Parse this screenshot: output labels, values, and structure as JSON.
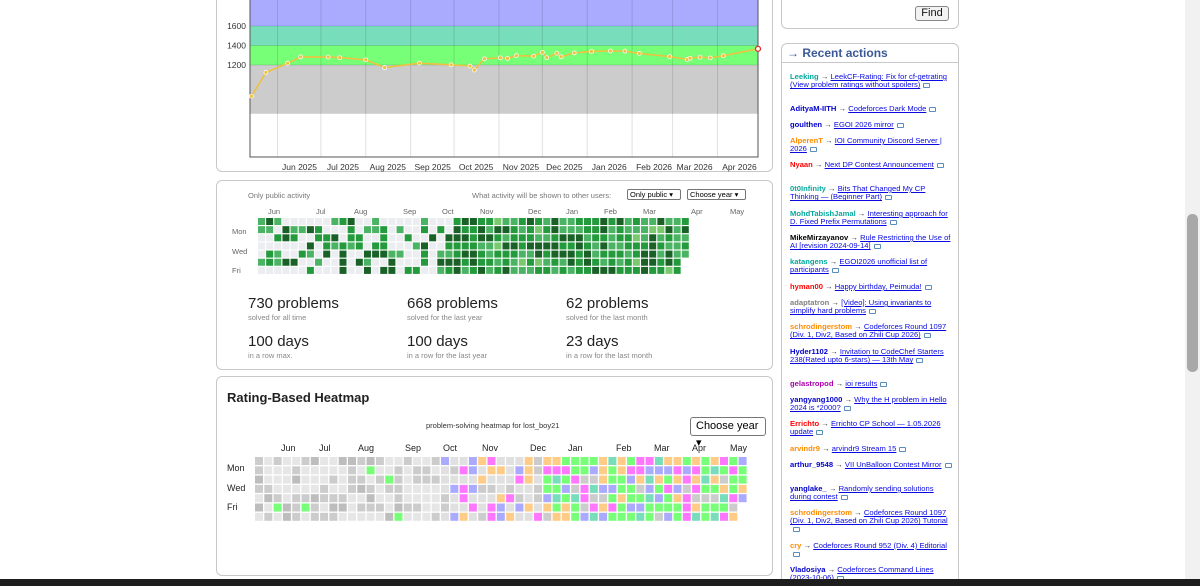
{
  "rating_chart": {
    "type": "line",
    "y_tick_labels": [
      "1600",
      "1400",
      "1200"
    ],
    "x_tick_labels": [
      "Jun 2025",
      "Jul 2025",
      "Aug 2025",
      "Sep 2025",
      "Oct 2025",
      "Nov 2025",
      "Dec 2025",
      "Jan 2026",
      "Feb 2026",
      "Mar 2026",
      "Apr 2026"
    ],
    "bands": [
      {
        "from": 1600,
        "to": 2000,
        "color": "#aaaaff"
      },
      {
        "from": 1400,
        "to": 1600,
        "color": "#77ddbb"
      },
      {
        "from": 1200,
        "to": 1400,
        "color": "#77ff77"
      },
      {
        "from": 700,
        "to": 1200,
        "color": "#cccccc"
      }
    ],
    "line_color": "#edc240",
    "last_point_color": "#e03030"
  },
  "chart_data": {
    "type": "line",
    "x": [
      "2025-05-14",
      "2025-05-24",
      "2025-06-08",
      "2025-06-17",
      "2025-07-06",
      "2025-07-14",
      "2025-08-01",
      "2025-08-14",
      "2025-09-07",
      "2025-09-29",
      "2025-10-12",
      "2025-10-15",
      "2025-10-22",
      "2025-11-02",
      "2025-11-07",
      "2025-11-13",
      "2025-11-25",
      "2025-12-01",
      "2025-12-04",
      "2025-12-11",
      "2025-12-14",
      "2025-12-23",
      "2026-01-04",
      "2026-01-17",
      "2026-01-27",
      "2026-02-06",
      "2026-02-27",
      "2026-03-11",
      "2026-03-13",
      "2026-03-20",
      "2026-03-27",
      "2026-04-05",
      "2026-04-29"
    ],
    "y": [
      880,
      1124,
      1218,
      1283,
      1281,
      1276,
      1253,
      1174,
      1219,
      1202,
      1190,
      1148,
      1264,
      1274,
      1268,
      1296,
      1291,
      1330,
      1275,
      1321,
      1284,
      1324,
      1339,
      1344,
      1342,
      1319,
      1286,
      1257,
      1270,
      1280,
      1273,
      1295,
      1366
    ],
    "ylim": [
      700,
      2000
    ]
  },
  "activity": {
    "only_public_label": "Only public activity",
    "shown_question": "What activity will be shown to other users:",
    "visibility_value": "Only public",
    "year_value": "Choose year",
    "months": [
      "Jun",
      "Jul",
      "Aug",
      "Sep",
      "Oct",
      "Nov",
      "Dec",
      "Jan",
      "Feb",
      "Mar",
      "Apr",
      "May"
    ],
    "days": [
      "Mon",
      "Wed",
      "Fri"
    ],
    "stats": [
      {
        "value": "730 problems",
        "label": "solved for all time"
      },
      {
        "value": "668 problems",
        "label": "solved for the last year"
      },
      {
        "value": "62 problems",
        "label": "solved for the last month"
      },
      {
        "value": "100 days",
        "label": "in a row max."
      },
      {
        "value": "100 days",
        "label": "in a row for the last year"
      },
      {
        "value": "23 days",
        "label": "in a row for the last month"
      }
    ]
  },
  "heatmap": {
    "title": "Rating-Based Heatmap",
    "caption": "problem-solving heatmap for lost_boy21",
    "year_value": "Choose year",
    "months": [
      "Jun",
      "Jul",
      "Aug",
      "Sep",
      "Oct",
      "Nov",
      "Dec",
      "Jan",
      "Feb",
      "Mar",
      "Apr",
      "May"
    ],
    "days": [
      "Mon",
      "Wed",
      "Fri"
    ]
  },
  "find": {
    "button_label": "Find"
  },
  "recent_actions": {
    "arrow": "→",
    "title": "Recent actions",
    "items": [
      {
        "user": "Leeking",
        "color": "#03a89e",
        "title": "LeekCF-Rating: Fix for cf-getrating (View problem ratings without spoilers)"
      },
      {
        "user": "AdityaM-IITH",
        "color": "#0000cc",
        "title": "Codeforces Dark Mode"
      },
      {
        "user": "goulthen",
        "color": "#0000cc",
        "title": "EGOI 2026 mirror"
      },
      {
        "user": "AlperenT",
        "color": "#ff8c00",
        "title": "IOI Community Discord Server | 2026"
      },
      {
        "user": "Nyaan",
        "color": "#ff0000",
        "title": "Next DP Contest Announcement"
      },
      {
        "user": "0t0Infinity",
        "color": "#03a89e",
        "title": "Bits That Changed My CP Thinking — (Beginner Part)"
      },
      {
        "user": "MohdTabishJamal",
        "color": "#03a89e",
        "title": "Interesting approach for D. Fixed Prefix Permutations"
      },
      {
        "user": "MikeMirzayanov",
        "color": "#000000",
        "title": "Rule Restricting the Use of AI [revision 2024-09-14]"
      },
      {
        "user": "katangens",
        "color": "#03a89e",
        "title": "EGOI2026 unofficial list of participants"
      },
      {
        "user": "hyman00",
        "color": "#ff0000",
        "title": "Happy birthday, Peimuda!"
      },
      {
        "user": "adaptatron",
        "color": "#808080",
        "title": "[Video]: Using invariants to simplify hard problems"
      },
      {
        "user": "schrodingerstom",
        "color": "#ff8c00",
        "title": "Codeforces Round 1097 (Div. 1, Div2, Based on Zhili Cup 2026)"
      },
      {
        "user": "Hyder1102",
        "color": "#0000cc",
        "title": "Invitation to CodeChef Starters 238(Rated upto 6-stars) — 13th May"
      },
      {
        "user": "gelastropod",
        "color": "#aa00aa",
        "title": "ioi results"
      },
      {
        "user": "yangyang1000",
        "color": "#0000cc",
        "title": "Why the H problem in Hello 2024 is *2000?"
      },
      {
        "user": "Errichto",
        "color": "#ff0000",
        "title": "Errichto CP School — 1.05.2026 update"
      },
      {
        "user": "arvindr9",
        "color": "#ff8c00",
        "title": "arvindr9 Stream 15"
      },
      {
        "user": "arthur_9548",
        "color": "#0000cc",
        "title": "VII UnBalloon Contest Mirror"
      },
      {
        "user": "yanglake_",
        "color": "#0000cc",
        "title": "Randomly sending solutions during contest"
      },
      {
        "user": "schrodingerstom",
        "color": "#ff8c00",
        "title": "Codeforces Round 1097 (Div. 1, Div2, Based on Zhili Cup 2026) Tutorial"
      },
      {
        "user": "cry",
        "color": "#ff8c00",
        "title": "Codeforces Round 952 (Div. 4) Editorial"
      },
      {
        "user": "Vladosiya",
        "color": "#0000cc",
        "title": "Codeforces Command Lines (2023-10-06)"
      }
    ]
  }
}
